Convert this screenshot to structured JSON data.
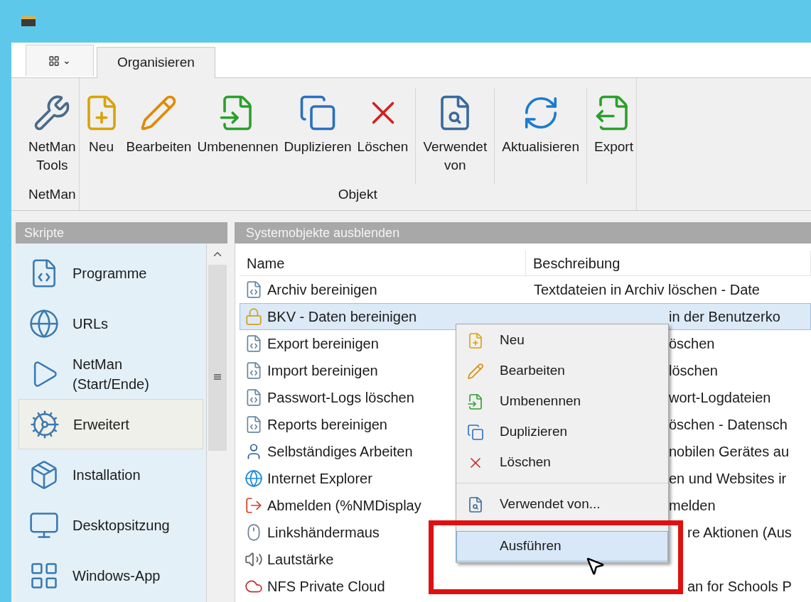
{
  "menu_button": {
    "label": "⌄"
  },
  "tabs": [
    {
      "label": "Organisieren",
      "selected": true
    }
  ],
  "ribbon_groups": [
    {
      "label": "NetMan",
      "sections": [
        [
          {
            "label": "NetMan Tools",
            "kind": "tools"
          }
        ]
      ]
    },
    {
      "label": "Objekt",
      "sections": [
        [
          {
            "label": "Neu",
            "kind": "new"
          },
          {
            "label": "Bearbeiten",
            "kind": "edit"
          },
          {
            "label": "Umbenennen",
            "kind": "rename"
          },
          {
            "label": "Duplizieren",
            "kind": "duplicate"
          },
          {
            "label": "Löschen",
            "kind": "delete"
          }
        ],
        [
          {
            "label": "Verwendet von",
            "kind": "usedby"
          }
        ],
        [
          {
            "label": "Aktualisieren",
            "kind": "refresh"
          }
        ],
        [
          {
            "label": "Export",
            "kind": "export"
          }
        ]
      ]
    }
  ],
  "sidebar": {
    "title": "Skripte",
    "items": [
      {
        "label": "Programme",
        "selected": false
      },
      {
        "label": "URLs",
        "selected": false
      },
      {
        "label": "NetMan (Start/Ende)",
        "selected": false
      },
      {
        "label": "Erweitert",
        "selected": true
      },
      {
        "label": "Installation",
        "selected": false
      },
      {
        "label": "Desktopsitzung",
        "selected": false
      },
      {
        "label": "Windows-App",
        "selected": false
      }
    ]
  },
  "main": {
    "title": "Systemobjekte ausblenden",
    "columns": [
      "Name",
      "Beschreibung"
    ],
    "rows": [
      {
        "name": "Archiv bereinigen",
        "description": "Textdateien in Archiv löschen - Date",
        "kind": "full",
        "selected": false
      },
      {
        "name": "BKV - Daten bereinigen",
        "description": "in der Benutzerko",
        "kind": "under_menu",
        "selected": true
      },
      {
        "name": "Export bereinigen",
        "description": "öschen",
        "kind": "under_menu",
        "selected": false
      },
      {
        "name": "Import bereinigen",
        "description": "löschen",
        "kind": "under_menu",
        "selected": false
      },
      {
        "name": "Passwort-Logs löschen",
        "description": "wort-Logdateien",
        "kind": "under_menu",
        "selected": false
      },
      {
        "name": "Reports bereinigen",
        "description": "öschen - Datensch",
        "kind": "under_menu",
        "selected": false
      },
      {
        "name": "Selbständiges Arbeiten",
        "description": "nobilen Gerätes au",
        "kind": "under_menu",
        "selected": false
      },
      {
        "name": "Internet Explorer",
        "description": "en und Websites ir",
        "kind": "under_menu",
        "selected": false
      },
      {
        "name": "Abmelden (%NMDisplay",
        "description": "melden",
        "kind": "under_menu",
        "selected": false
      },
      {
        "name": "Linkshändermaus",
        "description": "re Aktionen (Aus",
        "kind": "under_frame",
        "selected": false
      },
      {
        "name": "Lautstärke",
        "selected": false
      },
      {
        "name": "NFS Private Cloud",
        "description": "an for Schools P",
        "kind": "under_frame",
        "selected": false
      }
    ]
  },
  "context_menu": {
    "sections": [
      [
        {
          "label": "Neu",
          "kind": "new",
          "selected": false
        },
        {
          "label": "Bearbeiten",
          "kind": "edit",
          "selected": false
        },
        {
          "label": "Umbenennen",
          "kind": "rename",
          "selected": false
        },
        {
          "label": "Duplizieren",
          "kind": "duplicate",
          "selected": false
        },
        {
          "label": "Löschen",
          "kind": "delete",
          "selected": false
        }
      ],
      [
        {
          "label": "Verwendet von...",
          "kind": "usedby",
          "selected": false
        }
      ],
      [
        {
          "label": "Ausführen",
          "kind": "run",
          "selected": true
        }
      ]
    ]
  }
}
